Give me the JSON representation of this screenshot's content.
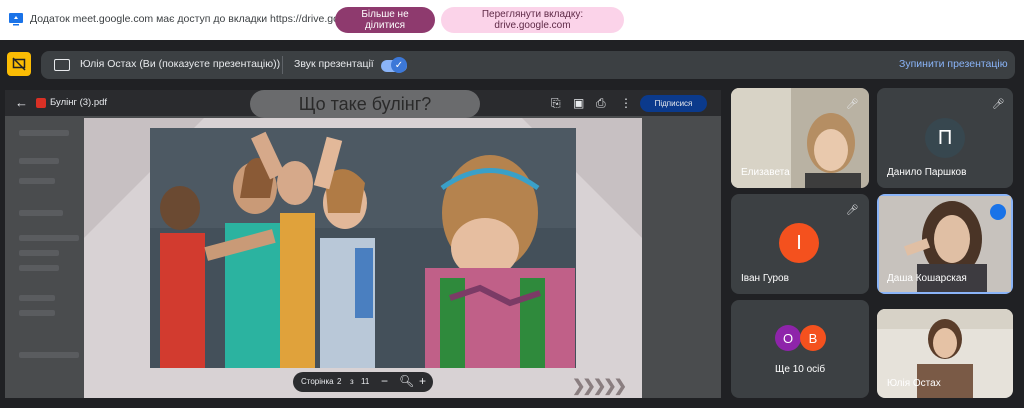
{
  "banner": {
    "notice": "Додаток meet.google.com має доступ до вкладки https://drive.google.com",
    "stop_sharing": "Більше не ділитися",
    "view_tab": "Переглянути вкладку: drive.google.com"
  },
  "presentation_bar": {
    "title": "Юлія Остах (Ви (показуєте презентацію))",
    "sound_label": "Звук презентації",
    "sound_on": true,
    "stop_presenting": "Зупинити презентацію"
  },
  "pdf_viewer": {
    "file_name": "Булінг (3).pdf",
    "subscribe": "Підписися",
    "slide_heading": "Що таке булінг?",
    "page_label": "Сторінка",
    "current_page": "2",
    "page_sep": "з",
    "total_pages": "11"
  },
  "participants": [
    {
      "name": "Елизавета",
      "muted": true,
      "video": true
    },
    {
      "name": "Данило Паршков",
      "muted": true,
      "video": false,
      "initial": "П",
      "color": "#37474f"
    },
    {
      "name": "Іван Гуров",
      "muted": true,
      "video": false,
      "initial": "І",
      "color": "#f4511e"
    },
    {
      "name": "Даша Кошарская",
      "muted": false,
      "speaking": true,
      "video": true
    },
    {
      "name": "Ще 10 осіб",
      "avatars": [
        "О",
        "В"
      ],
      "avatar_colors": [
        "#8e24aa",
        "#f4511e"
      ]
    },
    {
      "name": "Юлія Остах",
      "video": true
    }
  ],
  "colors": {
    "accent": "#8ab4f8",
    "stop_share_btn": "#8e3a6e",
    "view_tab_btn": "#fbd3e9",
    "meet_dark": "#202124",
    "tile": "#3c4043",
    "present_off": "#fbbc04"
  }
}
